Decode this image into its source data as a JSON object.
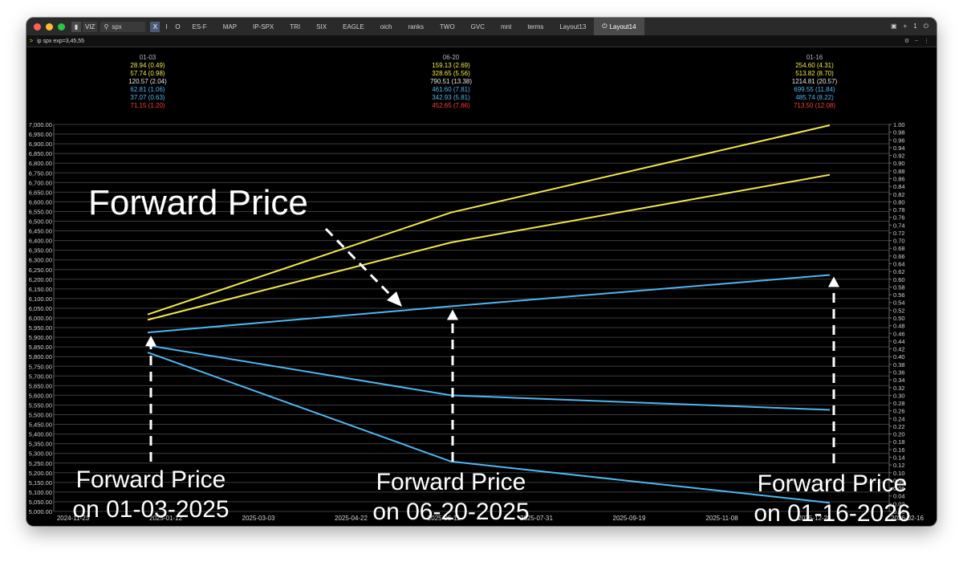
{
  "toolbar": {
    "viz_label": "VIZ",
    "search_value": "spx",
    "x_label": "X",
    "i_label": "I",
    "o_label": "O",
    "tabs": [
      "ES-F",
      "MAP",
      "IP-SPX",
      "TRI",
      "SIX",
      "EAGLE",
      "oich",
      "ranks",
      "TWO",
      "GVC",
      "mnt",
      "terms",
      "Layout13",
      "Layout14"
    ],
    "active_tab": "Layout14",
    "right_plus": "+",
    "right_one": "1"
  },
  "command": {
    "prompt": ">",
    "text": "ip spx exp=3,45,55"
  },
  "headers": [
    {
      "date": "01-03",
      "rows": [
        "28.94 (0.49)",
        "57.74 (0.98)",
        "120.57 (2.04)",
        "62.81 (1.06)",
        "37.07 (0.63)",
        "71.15 (1.20)"
      ]
    },
    {
      "date": "06-20",
      "rows": [
        "159.13 (2.69)",
        "328.65 (5.56)",
        "790.51 (13.38)",
        "461.60 (7.81)",
        "342.93 (5.81)",
        "452.65 (7.66)"
      ]
    },
    {
      "date": "01-16",
      "rows": [
        "254.60 (4.31)",
        "513.82 (8.70)",
        "1214.81 (20.57)",
        "699.55 (11.84)",
        "485.74 (8.22)",
        "713.50 (12.08)"
      ]
    }
  ],
  "header_row_colors": [
    "#f1e94a",
    "#f1e94a",
    "#e6e6e6",
    "#4fb7f0",
    "#4fb7f0",
    "#ff3b3b"
  ],
  "annotations": {
    "forward_price_big": "Forward Price",
    "label_1_line1": "Forward Price",
    "label_1_line2": "on 01-03-2025",
    "label_2_line1": "Forward Price",
    "label_2_line2": "on 06-20-2025",
    "label_3_line1": "Forward Price",
    "label_3_line2": "on 01-16-2026"
  },
  "chart_data": {
    "type": "line",
    "x": [
      "01-03",
      "06-20",
      "01-16"
    ],
    "ylim": [
      5000,
      7000
    ],
    "y_ticks": [
      "7,000.00",
      "6,950.00",
      "6,900.00",
      "6,850.00",
      "6,800.00",
      "6,750.00",
      "6,700.00",
      "6,650.00",
      "6,600.00",
      "6,550.00",
      "6,500.00",
      "6,450.00",
      "6,400.00",
      "6,350.00",
      "6,300.00",
      "6,250.00",
      "6,200.00",
      "6,150.00",
      "6,100.00",
      "6,050.00",
      "6,000.00",
      "5,950.00",
      "5,900.00",
      "5,850.00",
      "5,800.00",
      "5,750.00",
      "5,700.00",
      "5,650.00",
      "5,600.00",
      "5,550.00",
      "5,500.00",
      "5,450.00",
      "5,400.00",
      "5,350.00",
      "5,300.00",
      "5,250.00",
      "5,200.00",
      "5,150.00",
      "5,100.00",
      "5,050.00",
      "5,000.00"
    ],
    "y2lim": [
      0,
      1
    ],
    "y2_ticks": [
      "1.00",
      "0.98",
      "0.96",
      "0.94",
      "0.92",
      "0.90",
      "0.88",
      "0.86",
      "0.84",
      "0.82",
      "0.80",
      "0.78",
      "0.76",
      "0.74",
      "0.72",
      "0.70",
      "0.68",
      "0.66",
      "0.64",
      "0.62",
      "0.60",
      "0.58",
      "0.56",
      "0.54",
      "0.52",
      "0.50",
      "0.48",
      "0.46",
      "0.44",
      "0.42",
      "0.40",
      "0.38",
      "0.36",
      "0.34",
      "0.32",
      "0.30",
      "0.28",
      "0.26",
      "0.24",
      "0.22",
      "0.20",
      "0.18",
      "0.16",
      "0.14",
      "0.12",
      "0.10",
      "0.08",
      "0.06",
      "0.04",
      "0.02",
      "0.00"
    ],
    "x_ticks": [
      "2024-11-23",
      "2025-01-12",
      "2025-03-03",
      "2025-04-22",
      "2025-06-11",
      "2025-07-31",
      "2025-09-19",
      "2025-11-08",
      "2025-12-28",
      "2026-02-16"
    ],
    "grid": true,
    "series": [
      {
        "color": "#f1e94a",
        "values": [
          6018,
          6545,
          6996
        ]
      },
      {
        "color": "#f1e94a",
        "values": [
          5990,
          6390,
          6740
        ]
      },
      {
        "color": "#4fb7f0",
        "values": [
          5925,
          6060,
          6222
        ]
      },
      {
        "color": "#4fb7f0",
        "values": [
          5858,
          5600,
          5525
        ]
      },
      {
        "color": "#4fb7f0",
        "values": [
          5822,
          5258,
          5045
        ]
      }
    ]
  }
}
